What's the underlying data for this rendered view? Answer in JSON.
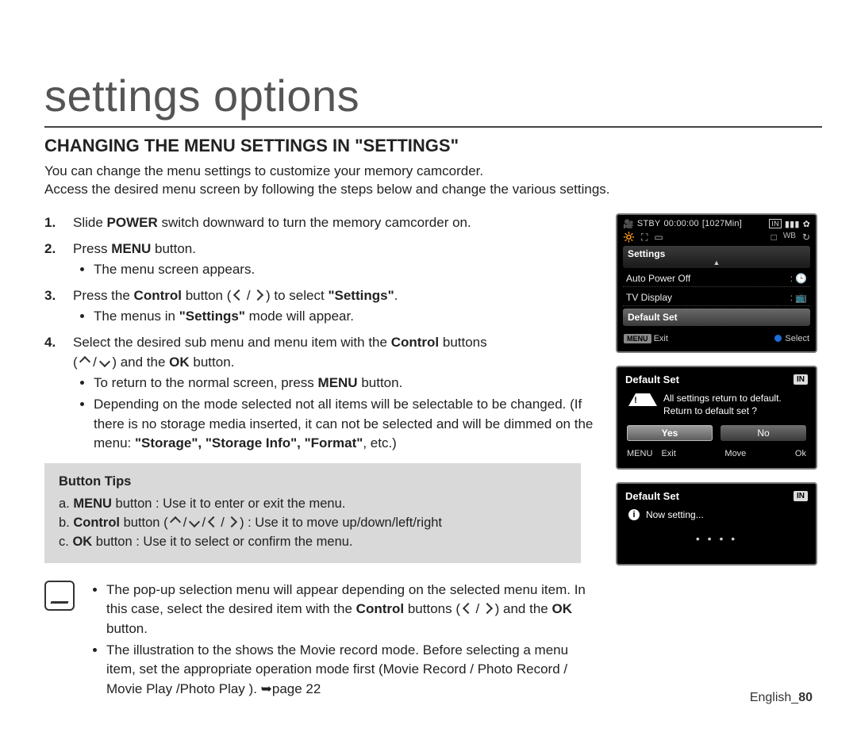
{
  "page_title": "settings options",
  "section_title": "CHANGING THE MENU SETTINGS IN \"SETTINGS\"",
  "intro_1": "You can change the menu settings to customize your memory camcorder.",
  "intro_2": "Access the desired menu screen by following the steps below and change the various settings.",
  "steps": {
    "s1_a": "Slide",
    "s1_b": "POWER",
    "s1_c": "switch downward to turn the memory camcorder on.",
    "s2_a": "Press",
    "s2_b": "MENU",
    "s2_c": "button.",
    "s2_sub1": "The menu screen appears.",
    "s3_a": "Press the",
    "s3_b": "Control",
    "s3_c": "button (",
    "s3_d": ") to select",
    "s3_e": "\"Settings\"",
    "s3_f": ".",
    "s3_sub1_a": "The menus in",
    "s3_sub1_b": "\"Settings\"",
    "s3_sub1_c": "mode will appear.",
    "s4_a": "Select the desired sub menu and menu item with the",
    "s4_b": "Control",
    "s4_c": "buttons",
    "s4_d": "(",
    "s4_e": ") and the",
    "s4_f": "OK",
    "s4_g": "button.",
    "s4_sub1_a": "To return to the normal screen, press",
    "s4_sub1_b": "MENU",
    "s4_sub1_c": "button.",
    "s4_sub2": "Depending on the mode selected not all items will be selectable to be changed. (If there is no storage media inserted, it can not be selected and will be dimmed on the menu:",
    "s4_sub2_b": "\"Storage\", \"Storage Info\", \"Format\"",
    "s4_sub2_c": ", etc.)"
  },
  "tips": {
    "title": "Button Tips",
    "a1": "a.",
    "a2": "MENU",
    "a3": "button : Use it to enter or exit the menu.",
    "b1": "b.",
    "b2": "Control",
    "b3": "button (",
    "b4": ") : Use it to move up/down/left/right",
    "c1": "c.",
    "c2": "OK",
    "c3": "button : Use it to select or confirm the menu."
  },
  "note": {
    "n1_a": "The pop-up selection menu will appear depending on the selected menu item. In this case, select the desired item with the",
    "n1_b": "Control",
    "n1_c": "buttons (",
    "n1_d": ") and the",
    "n1_e": "OK",
    "n1_f": "button.",
    "n2": "The illustration to the shows the Movie record mode.   Before selecting a menu item, set the appropriate operation mode first (Movie Record / Photo Record / Movie Play /Photo Play ). ➥page 22"
  },
  "lcd1": {
    "stby": "STBY",
    "time": "00:00:00",
    "remain": "[1027Min]",
    "in": "IN",
    "tab": "Settings",
    "item1": "Auto Power Off",
    "item2": "TV Display",
    "item3": "Default Set",
    "foot_menu": "MENU",
    "foot_exit": "Exit",
    "foot_select": "Select"
  },
  "lcd2": {
    "title": "Default Set",
    "in": "IN",
    "msg1": "All settings return to default.",
    "msg2": "Return to default set ?",
    "yes": "Yes",
    "no": "No",
    "foot_menu": "MENU",
    "foot_exit": "Exit",
    "foot_move": "Move",
    "foot_ok": "Ok"
  },
  "lcd3": {
    "title": "Default Set",
    "in": "IN",
    "msg": "Now setting...",
    "dots": "• • • •"
  },
  "footer": {
    "lang": "English_",
    "page": "80"
  }
}
